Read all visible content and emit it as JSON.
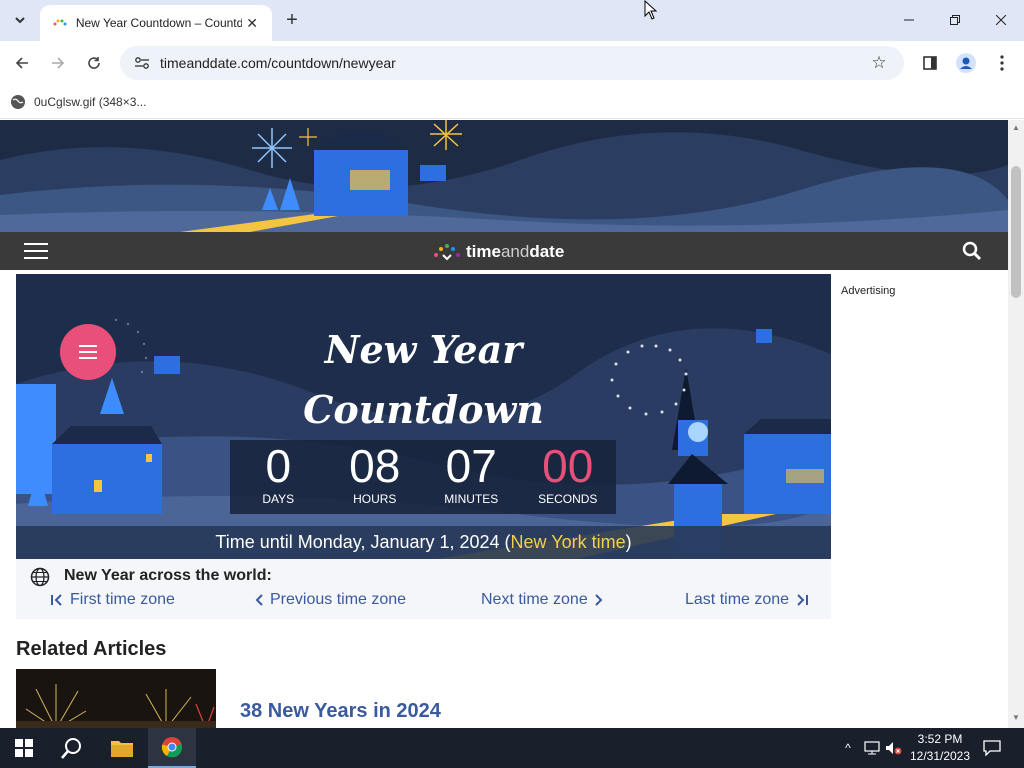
{
  "browser": {
    "tab_title": "New Year Countdown – Countd",
    "url": "timeanddate.com/countdown/newyear",
    "bookmark_label": "0uCglsw.gif (348×3..."
  },
  "site": {
    "logo_part1": "time",
    "logo_part2": "and",
    "logo_part3": "date"
  },
  "countdown": {
    "title_line1": "New Year",
    "title_line2": "Countdown",
    "units": [
      {
        "value": "0",
        "label": "DAYS"
      },
      {
        "value": "08",
        "label": "HOURS"
      },
      {
        "value": "07",
        "label": "MINUTES"
      },
      {
        "value": "00",
        "label": "SECONDS"
      }
    ],
    "footer_prefix": "Time until Monday, January 1, 2024 (",
    "footer_tz": "New York time",
    "footer_suffix": ")"
  },
  "sidebar": {
    "advertising": "Advertising"
  },
  "world": {
    "title": "New Year across the world:",
    "first": "First time zone",
    "previous": "Previous time zone",
    "next": "Next time zone",
    "last": "Last time zone"
  },
  "related": {
    "heading": "Related Articles",
    "article_title": "38 New Years in 2024"
  },
  "taskbar": {
    "time": "3:52 PM",
    "date": "12/31/2023"
  },
  "colors": {
    "accent_pink": "#e8507a",
    "link_blue": "#3a5a9f",
    "timezone_yellow": "#f4d04a"
  }
}
